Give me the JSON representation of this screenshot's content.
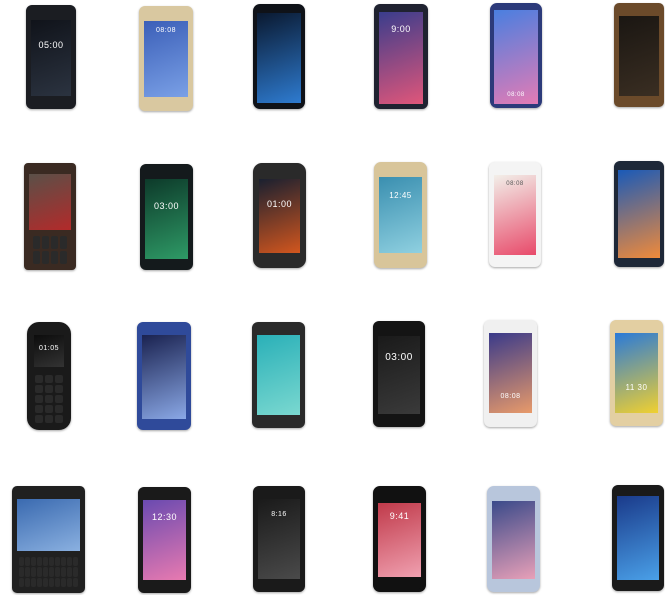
{
  "phones": [
    {
      "id": "p1",
      "screen_text": "05:00",
      "bezel": "#1b1d22",
      "screen": "#10131a",
      "accent": "#2b3340"
    },
    {
      "id": "p2",
      "screen_text": "08:08",
      "bezel": "#d9c8a0",
      "screen": "#3b5fb8",
      "accent": "#7aa0e6"
    },
    {
      "id": "p3",
      "screen_text": "",
      "bezel": "#0f1218",
      "screen": "#0a1930",
      "accent": "#2e7bd0"
    },
    {
      "id": "p4",
      "screen_text": "9:00",
      "bezel": "#1f2230",
      "screen": "#3a3d8c",
      "accent": "#e0567a"
    },
    {
      "id": "p5",
      "screen_text": "08:08",
      "bezel": "#2c3a7a",
      "screen": "#4a7fe0",
      "accent": "#e37bb5"
    },
    {
      "id": "p6",
      "screen_text": "",
      "bezel": "#6b4a2a",
      "screen": "#1a1612",
      "accent": "#3a2e22"
    },
    {
      "id": "p7",
      "screen_text": "",
      "bezel": "#3a2a22",
      "screen": "#5a5048",
      "accent": "#b32a2a"
    },
    {
      "id": "p8",
      "screen_text": "03:00",
      "bezel": "#141a1c",
      "screen": "#0d3a2a",
      "accent": "#2e9a66"
    },
    {
      "id": "p9",
      "screen_text": "01:00",
      "bezel": "#2a2a2a",
      "screen": "#1a2030",
      "accent": "#d2561e"
    },
    {
      "id": "p10",
      "screen_text": "12:45",
      "bezel": "#d8c59a",
      "screen": "#3a8fb0",
      "accent": "#8fd0e0"
    },
    {
      "id": "p11",
      "screen_text": "08:08",
      "bezel": "#f4f4f4",
      "screen": "#f2efe9",
      "accent": "#e84a6a"
    },
    {
      "id": "p12",
      "screen_text": "",
      "bezel": "#1e2838",
      "screen": "#1a5ab8",
      "accent": "#f08a3a"
    },
    {
      "id": "p13",
      "screen_text": "01:05",
      "bezel": "#1a1a1a",
      "screen": "#0c0c0c",
      "accent": "#333333"
    },
    {
      "id": "p14",
      "screen_text": "",
      "bezel": "#2f4a9a",
      "screen": "#1a2250",
      "accent": "#8aa8e6"
    },
    {
      "id": "p15",
      "screen_text": "",
      "bezel": "#2a2a2a",
      "screen": "#2ab0b8",
      "accent": "#7ad8d0"
    },
    {
      "id": "p16",
      "screen_text": "03:00",
      "bezel": "#141414",
      "screen": "#1a1a1a",
      "accent": "#3a3a3a"
    },
    {
      "id": "p17",
      "screen_text": "08:08",
      "bezel": "#f0f0f0",
      "screen": "#3a3a8a",
      "accent": "#e89a6a"
    },
    {
      "id": "p18",
      "screen_text": "11 30",
      "bezel": "#e3cfa2",
      "screen": "#2a7ad8",
      "accent": "#f0d030"
    },
    {
      "id": "p19",
      "screen_text": "",
      "bezel": "#202020",
      "screen": "#3a6ab0",
      "accent": "#8ab0e0"
    },
    {
      "id": "p20",
      "screen_text": "12:30",
      "bezel": "#1a1a1a",
      "screen": "#6a4ab0",
      "accent": "#e87ab0"
    },
    {
      "id": "p21",
      "screen_text": "8:16",
      "bezel": "#1a1a1a",
      "screen": "#1a1a1a",
      "accent": "#4a4a4a"
    },
    {
      "id": "p22",
      "screen_text": "9:41",
      "bezel": "#111111",
      "screen": "#c03a4a",
      "accent": "#f0a0b0"
    },
    {
      "id": "p23",
      "screen_text": "",
      "bezel": "#b8c6dc",
      "screen": "#3a4a8a",
      "accent": "#e8a0b8"
    },
    {
      "id": "p24",
      "screen_text": "",
      "bezel": "#1a1a1a",
      "screen": "#1a3a8a",
      "accent": "#4aa0e8"
    }
  ]
}
